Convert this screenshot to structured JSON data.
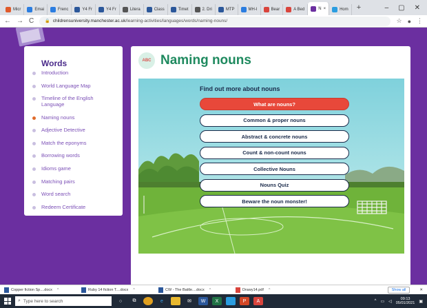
{
  "browser": {
    "tabs": [
      {
        "label": "Micr",
        "color": "#e05a2b"
      },
      {
        "label": "Emai",
        "color": "#2b7de0"
      },
      {
        "label": "Frenc",
        "color": "#2b7de0"
      },
      {
        "label": "Y4 Fr",
        "color": "#2b579a"
      },
      {
        "label": "Y4 Fr",
        "color": "#2b579a"
      },
      {
        "label": "Litera",
        "color": "#555"
      },
      {
        "label": "Class",
        "color": "#2b579a"
      },
      {
        "label": "Timet",
        "color": "#2b579a"
      },
      {
        "label": "2. Dri",
        "color": "#555"
      },
      {
        "label": "MTP",
        "color": "#2b579a"
      },
      {
        "label": "MH-I",
        "color": "#2b7de0"
      },
      {
        "label": "Bear",
        "color": "#d9443c"
      },
      {
        "label": "A Bed",
        "color": "#d9443c"
      },
      {
        "label": "N",
        "color": "#6b2fa0"
      },
      {
        "label": "Hom",
        "color": "#2b9de0"
      }
    ],
    "active_tab_index": 13,
    "new_tab": "+",
    "window_controls": [
      "–",
      "▢",
      "✕"
    ],
    "url_host": "childrensuniversity.manchester.ac.uk",
    "url_path": "/learning-activities/languages/words/naming-nouns/"
  },
  "sidebar": {
    "heading": "Words",
    "items": [
      {
        "label": "Introduction",
        "active": false
      },
      {
        "label": "World Language Map",
        "active": false
      },
      {
        "label": "Timeline of the English Language",
        "active": false
      },
      {
        "label": "Naming nouns",
        "active": true
      },
      {
        "label": "Adjective Detective",
        "active": false
      },
      {
        "label": "Match the eponyms",
        "active": false
      },
      {
        "label": "Borrowing words",
        "active": false
      },
      {
        "label": "Idioms game",
        "active": false
      },
      {
        "label": "Matching pairs",
        "active": false
      },
      {
        "label": "Word search",
        "active": false
      },
      {
        "label": "Redeem Certificate",
        "active": false
      }
    ]
  },
  "main": {
    "icon_text": "ABC",
    "title": "Naming nouns",
    "panel_heading": "Find out more about nouns",
    "buttons": [
      {
        "label": "What are nouns?",
        "primary": true
      },
      {
        "label": "Common & proper nouns",
        "primary": false
      },
      {
        "label": "Abstract & concrete nouns",
        "primary": false
      },
      {
        "label": "Count & non-count nouns",
        "primary": false
      },
      {
        "label": "Collective Nouns",
        "primary": false
      },
      {
        "label": "Nouns Quiz",
        "primary": false
      },
      {
        "label": "Beware the noun monster!",
        "primary": false
      }
    ]
  },
  "downloads": {
    "items": [
      {
        "label": "Copper fiction Sp....docx",
        "type": "docx"
      },
      {
        "label": "Ruby 14 fiction T....docx",
        "type": "docx"
      },
      {
        "label": "CW - The Battle....docx",
        "type": "docx"
      },
      {
        "label": "Drawy14.pdf",
        "type": "pdf"
      }
    ],
    "show_all": "Show all",
    "close": "✕"
  },
  "taskbar": {
    "search_placeholder": "Type here to search",
    "time": "09:13",
    "date": "05/01/2021"
  },
  "colors": {
    "page_bg": "#6b2fa0",
    "title_green": "#1f8a5f",
    "primary_button": "#e8483a",
    "sidebar_text": "#7b4fb6",
    "active_dot": "#e06b2b"
  }
}
